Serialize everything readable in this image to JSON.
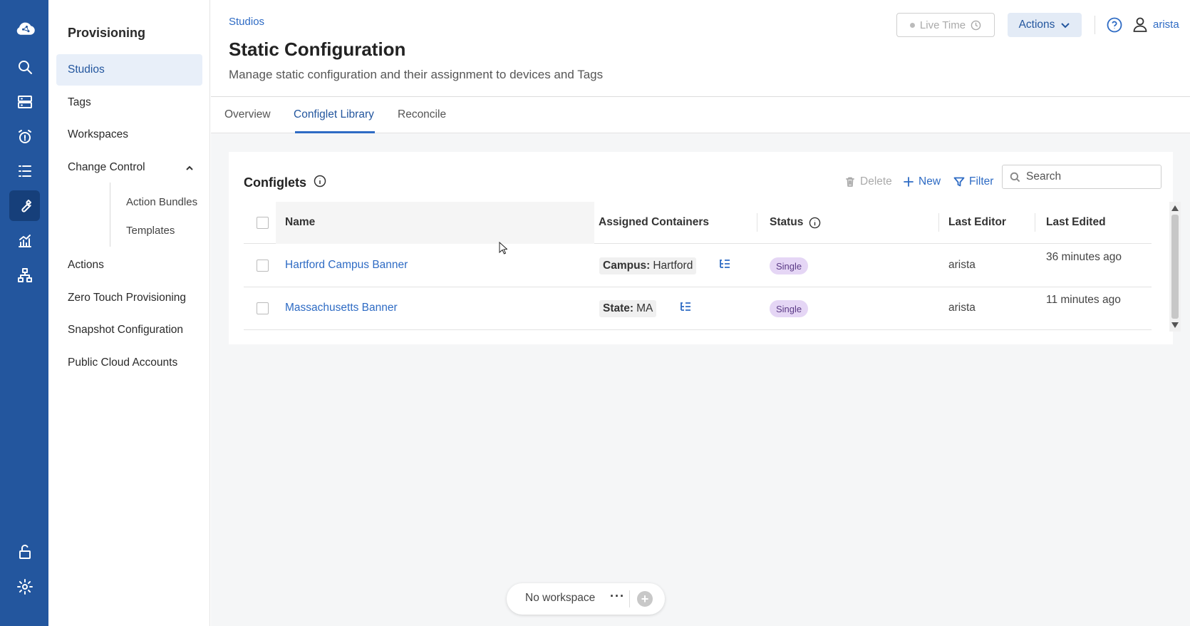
{
  "sidebar": {
    "title": "Provisioning",
    "items": [
      {
        "label": "Studios"
      },
      {
        "label": "Tags"
      },
      {
        "label": "Workspaces"
      },
      {
        "label": "Change Control"
      },
      {
        "label": "Action Bundles"
      },
      {
        "label": "Templates"
      },
      {
        "label": "Actions"
      },
      {
        "label": "Zero Touch Provisioning"
      },
      {
        "label": "Snapshot Configuration"
      },
      {
        "label": "Public Cloud Accounts"
      }
    ]
  },
  "header": {
    "breadcrumb": "Studios",
    "title": "Static Configuration",
    "subtitle": "Manage static configuration and their assignment to devices and Tags",
    "live_time_label": "Live Time",
    "actions_label": "Actions",
    "user": "arista"
  },
  "tabs": [
    {
      "label": "Overview"
    },
    {
      "label": "Configlet Library"
    },
    {
      "label": "Reconcile"
    }
  ],
  "card": {
    "title": "Configlets",
    "delete_label": "Delete",
    "new_label": "New",
    "filter_label": "Filter",
    "search_placeholder": "Search"
  },
  "table": {
    "columns": [
      "Name",
      "Assigned Containers",
      "Status",
      "Last Editor",
      "Last Edited"
    ],
    "rows": [
      {
        "name": "Hartford Campus Banner",
        "container_key": "Campus:",
        "container_value": "Hartford",
        "status": "Single",
        "editor": "arista",
        "edited": "36 minutes ago"
      },
      {
        "name": "Massachusetts Banner",
        "container_key": "State:",
        "container_value": "MA",
        "status": "Single",
        "editor": "arista",
        "edited": "11 minutes ago"
      }
    ]
  },
  "workspace": {
    "label": "No workspace",
    "more": "···"
  },
  "colors": {
    "rail": "#23569e",
    "accent": "#2e6bc4",
    "badge": "#e5d6f5"
  }
}
